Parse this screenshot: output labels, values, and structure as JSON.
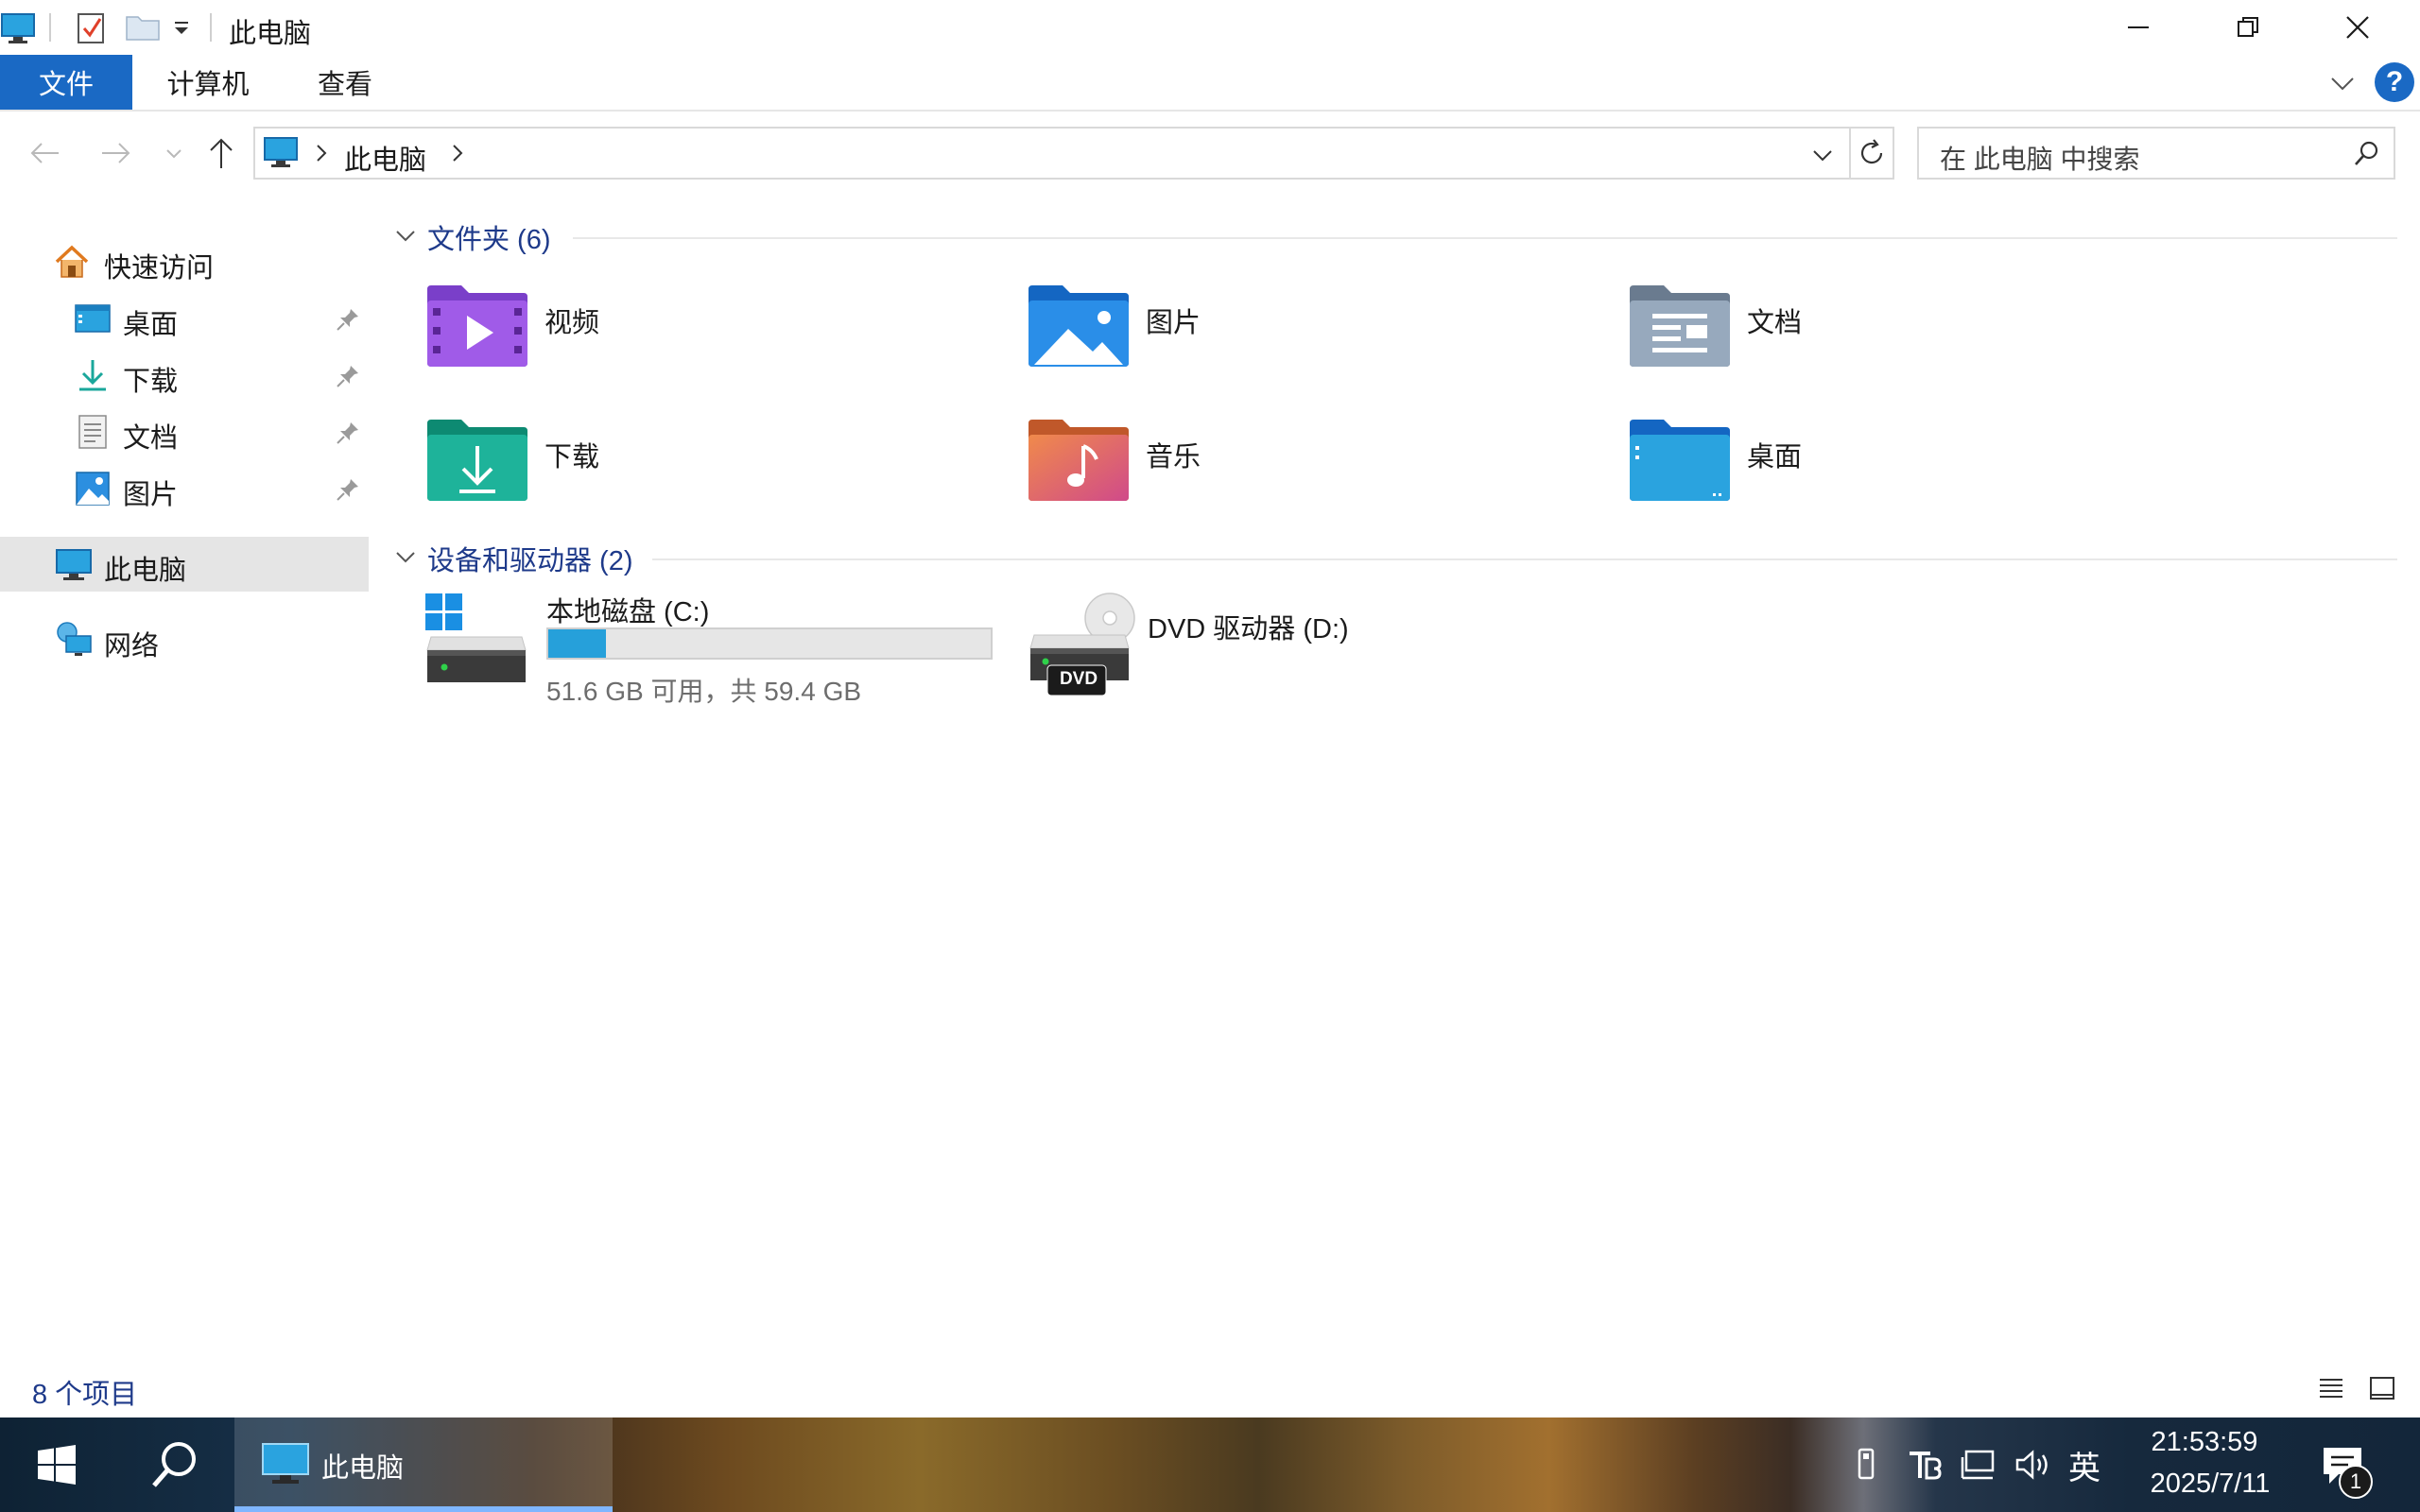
{
  "window": {
    "title": "此电脑",
    "controls": [
      "minimize",
      "restore",
      "close"
    ]
  },
  "ribbon": {
    "tabs": [
      {
        "label": "文件",
        "active": true
      },
      {
        "label": "计算机",
        "active": false
      },
      {
        "label": "查看",
        "active": false
      }
    ],
    "help_label": "?"
  },
  "address": {
    "path": "此电脑",
    "search_placeholder": "在 此电脑 中搜索"
  },
  "nav": {
    "quick_access": "快速访问",
    "pinned": [
      {
        "label": "桌面",
        "icon": "desktop-icon"
      },
      {
        "label": "下载",
        "icon": "download-icon"
      },
      {
        "label": "文档",
        "icon": "documents-icon"
      },
      {
        "label": "图片",
        "icon": "pictures-icon"
      }
    ],
    "this_pc": "此电脑",
    "network": "网络"
  },
  "content": {
    "folders_header": "文件夹 (6)",
    "folders": [
      {
        "label": "视频",
        "icon": "videos-folder-icon"
      },
      {
        "label": "图片",
        "icon": "pictures-folder-icon"
      },
      {
        "label": "文档",
        "icon": "documents-folder-icon"
      },
      {
        "label": "下载",
        "icon": "downloads-folder-icon"
      },
      {
        "label": "音乐",
        "icon": "music-folder-icon"
      },
      {
        "label": "桌面",
        "icon": "desktop-folder-icon"
      }
    ],
    "drives_header": "设备和驱动器 (2)",
    "drives": [
      {
        "name": "本地磁盘 (C:)",
        "free_text": "51.6 GB 可用，共 59.4 GB",
        "used_fraction": 0.131
      },
      {
        "name": "DVD 驱动器 (D:)",
        "badge": "DVD"
      }
    ]
  },
  "status": {
    "item_count": "8 个项目"
  },
  "taskbar": {
    "app_label": "此电脑",
    "ime": "英",
    "time": "21:53:59",
    "date": "2025/7/11",
    "notification_count": "1"
  },
  "colors": {
    "accent": "#1a69c4",
    "header_text": "#1e3a8a",
    "drive_fill": "#26a0da"
  }
}
